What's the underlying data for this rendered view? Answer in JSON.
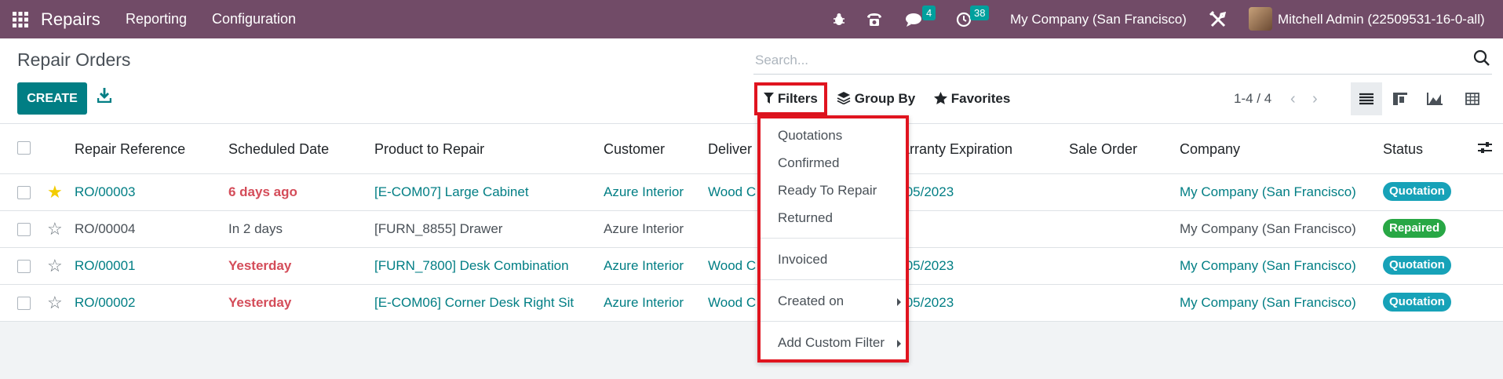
{
  "navbar": {
    "app_name": "Repairs",
    "menu": [
      "Reporting",
      "Configuration"
    ],
    "messages_count": "4",
    "activities_count": "38",
    "company": "My Company (San Francisco)",
    "user": "Mitchell Admin (22509531-16-0-all)"
  },
  "control_panel": {
    "breadcrumb": "Repair Orders",
    "create_label": "CREATE",
    "search_placeholder": "Search...",
    "filters_label": "Filters",
    "groupby_label": "Group By",
    "favorites_label": "Favorites",
    "pager": "1-4 / 4"
  },
  "table": {
    "headers": [
      "Repair Reference",
      "Scheduled Date",
      "Product to Repair",
      "Customer",
      "Deliver",
      "arranty Expiration",
      "Sale Order",
      "Company",
      "Status"
    ],
    "rows": [
      {
        "ref": "RO/00003",
        "date": "6 days ago",
        "product": "[E-COM07] Large Cabinet",
        "customer": "Azure Interior",
        "deliver": "Wood C",
        "warranty": "/05/2023",
        "company": "My Company (San Francisco)",
        "status": "Quotation",
        "starred": true
      },
      {
        "ref": "RO/00004",
        "date": "In 2 days",
        "product": "[FURN_8855] Drawer",
        "customer": "Azure Interior",
        "deliver": "",
        "warranty": "",
        "company": "My Company (San Francisco)",
        "status": "Repaired",
        "starred": false
      },
      {
        "ref": "RO/00001",
        "date": "Yesterday",
        "product": "[FURN_7800] Desk Combination",
        "customer": "Azure Interior",
        "deliver": "Wood C",
        "warranty": "/05/2023",
        "company": "My Company (San Francisco)",
        "status": "Quotation",
        "starred": false
      },
      {
        "ref": "RO/00002",
        "date": "Yesterday",
        "product": "[E-COM06] Corner Desk Right Sit",
        "customer": "Azure Interior",
        "deliver": "Wood C",
        "warranty": "/05/2023",
        "company": "My Company (San Francisco)",
        "status": "Quotation",
        "starred": false
      }
    ]
  },
  "filters_menu": {
    "items": [
      "Quotations",
      "Confirmed",
      "Ready To Repair",
      "Returned",
      "Invoiced",
      "Created on",
      "Add Custom Filter"
    ]
  },
  "colors": {
    "navbar": "#714b67",
    "primary": "#017e84",
    "highlight_box": "#e0141f",
    "danger_text": "#d44c59",
    "status_quotation": "#17a2b8",
    "status_repaired": "#28a745"
  }
}
